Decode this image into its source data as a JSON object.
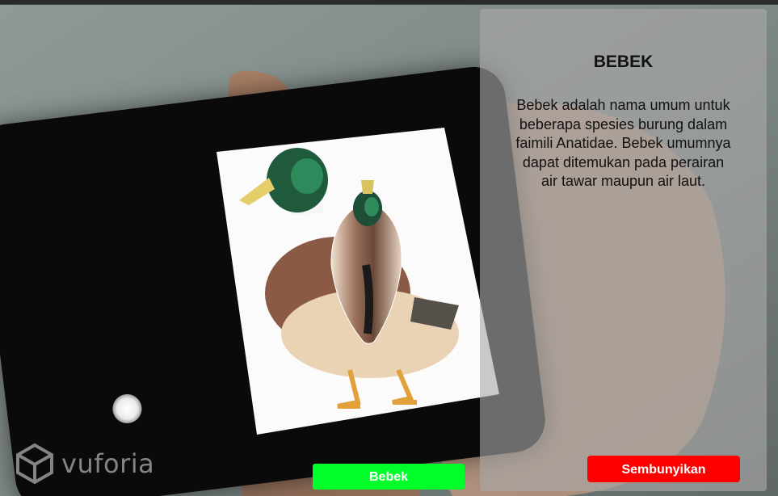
{
  "watermark": {
    "text": "vuforia",
    "icon": "vuforia-cube-logo"
  },
  "info_panel": {
    "title": "BEBEK",
    "description": "Bebek adalah nama umum untuk beberapa spesies burung dalam faimili Anatidae. Bebek umumnya dapat ditemukan pada perairan air tawar maupun air laut."
  },
  "buttons": {
    "bebek_label": "Bebek",
    "hide_label": "Sembunyikan"
  },
  "colors": {
    "bebek_button": "#00ff2a",
    "hide_button": "#ff0000",
    "panel": "rgba(170,170,170,0.62)"
  }
}
